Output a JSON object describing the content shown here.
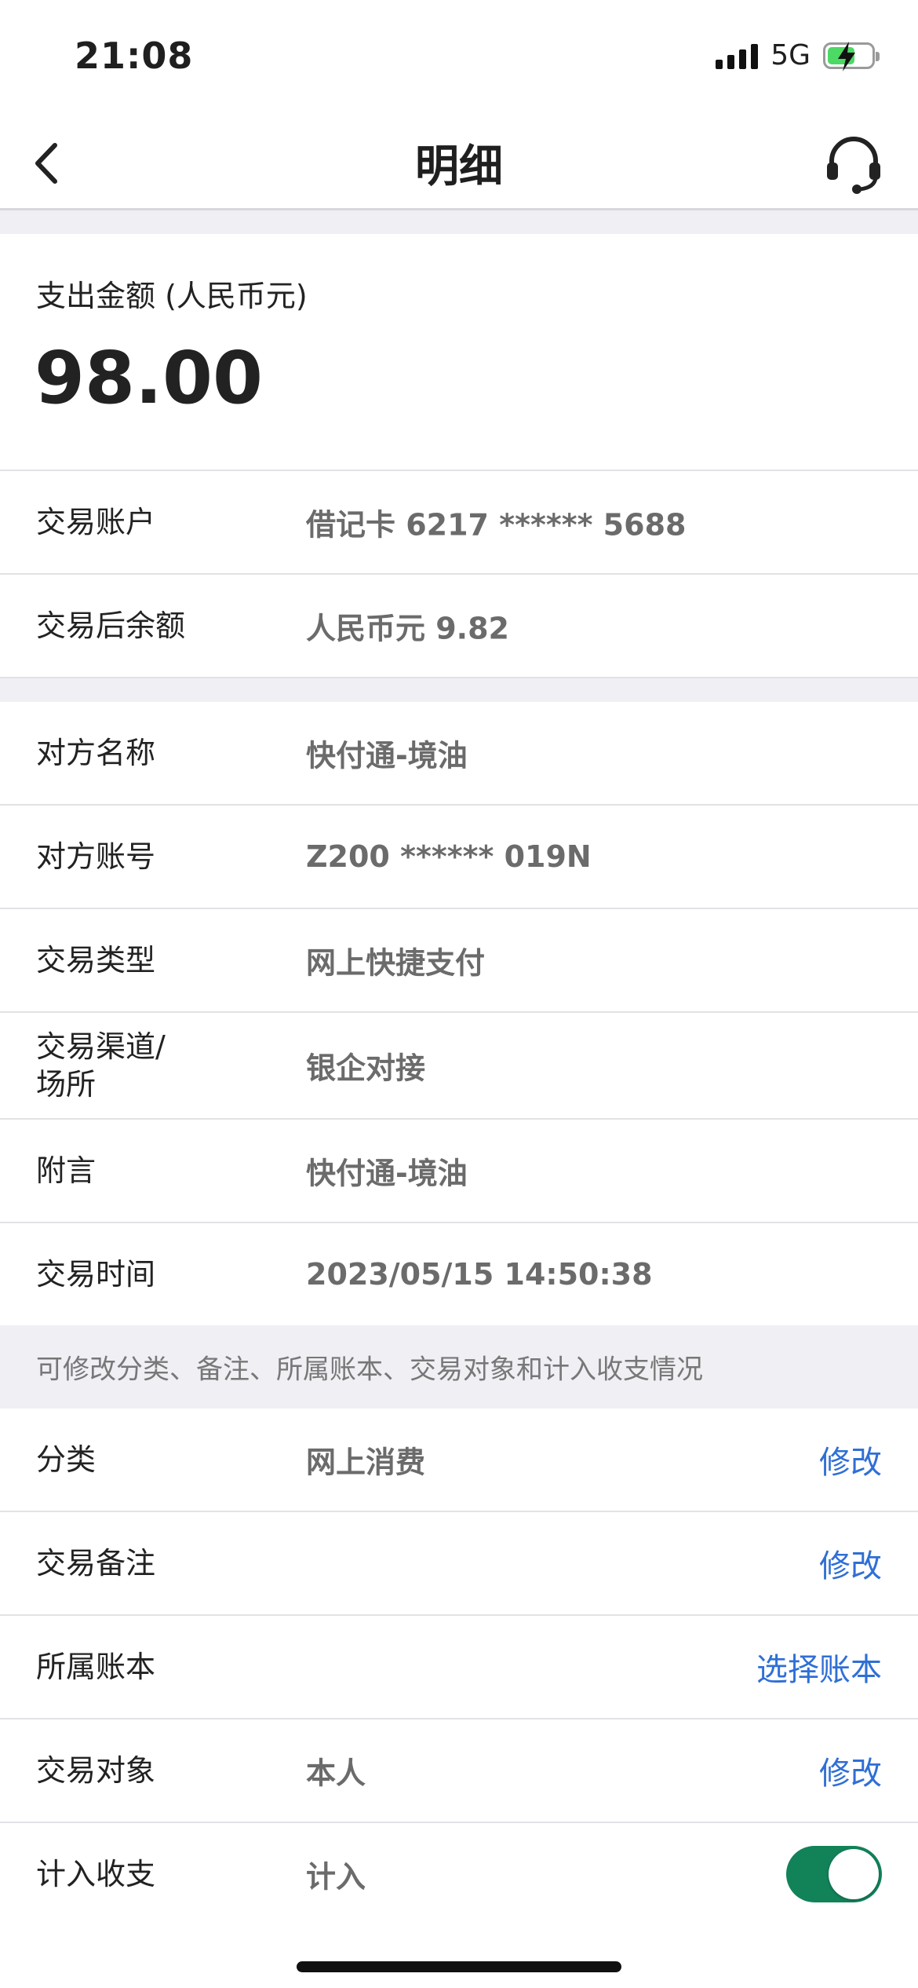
{
  "status": {
    "time": "21:08",
    "network": "5G"
  },
  "nav": {
    "title": "明细"
  },
  "amount": {
    "label": "支出金额 (人民币元)",
    "value": "98.00"
  },
  "section1": [
    {
      "label": "交易账户",
      "value": "借记卡 6217 ****** 5688"
    },
    {
      "label": "交易后余额",
      "value": "人民币元 9.82"
    }
  ],
  "section2": [
    {
      "label": "对方名称",
      "value": "快付通-境油"
    },
    {
      "label": "对方账号",
      "value": "Z200 ****** 019N"
    },
    {
      "label": "交易类型",
      "value": "网上快捷支付"
    },
    {
      "label": "交易渠道/\n场所",
      "value": "银企对接"
    },
    {
      "label": "附言",
      "value": "快付通-境油"
    },
    {
      "label": "交易时间",
      "value": "2023/05/15 14:50:38"
    }
  ],
  "hint": "可修改分类、备注、所属账本、交易对象和计入收支情况",
  "editable": [
    {
      "label": "分类",
      "value": "网上消费",
      "action": "修改"
    },
    {
      "label": "交易备注",
      "value": "",
      "action": "修改"
    },
    {
      "label": "所属账本",
      "value": "",
      "action": "选择账本"
    },
    {
      "label": "交易对象",
      "value": "本人",
      "action": "修改"
    }
  ],
  "include": {
    "label": "计入收支",
    "value": "计入",
    "on": true
  },
  "colors": {
    "accent": "#2f6fd6",
    "toggle": "#128259",
    "background_gap": "#efeff4"
  }
}
